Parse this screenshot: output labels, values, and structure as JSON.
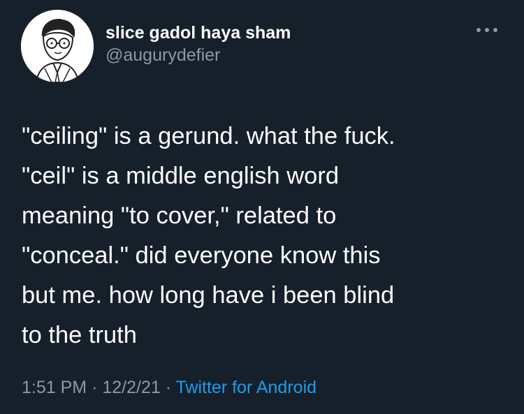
{
  "user": {
    "display_name": "slice gadol haya sham",
    "handle": "@augurydefier",
    "avatar_icon": "cartoon-man-with-glasses-avatar"
  },
  "tweet": {
    "text": "\"ceiling\" is a gerund. what the fuck.\n\"ceil\" is a middle english word\nmeaning \"to cover,\" related to\n\"conceal.\" did everyone know this\nbut me. how long have i been blind\nto the truth",
    "time": "1:51 PM",
    "date": "12/2/21",
    "separator": "·",
    "source": "Twitter for Android"
  },
  "colors": {
    "background": "#15202b",
    "text": "#ffffff",
    "muted": "#8b98a5",
    "link": "#1d9bf0"
  },
  "icons": {
    "more": "more-horizontal-icon"
  }
}
